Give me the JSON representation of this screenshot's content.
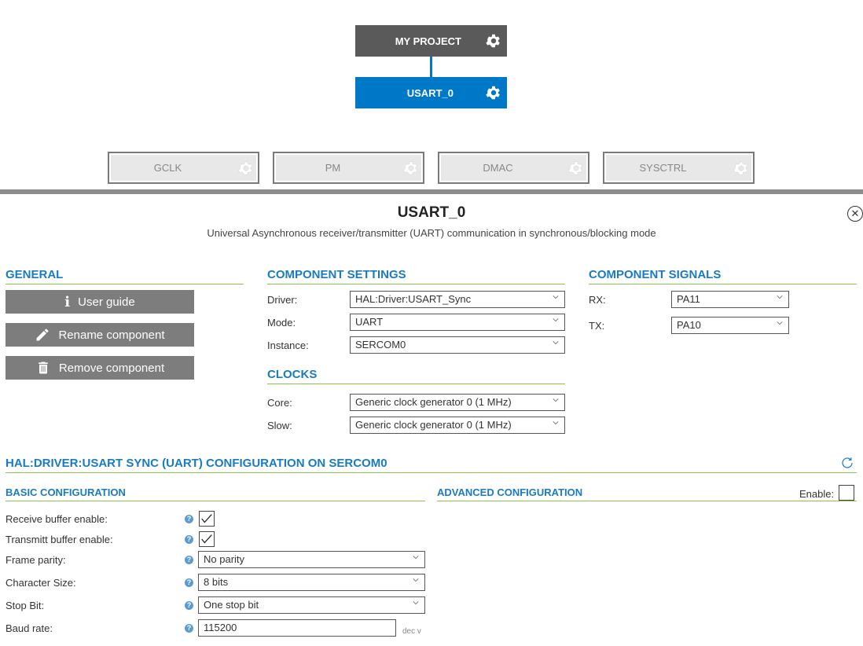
{
  "tree": {
    "root_label": "MY PROJECT",
    "component_label": "USART_0",
    "dependencies": [
      "GCLK",
      "PM",
      "DMAC",
      "SYSCTRL"
    ]
  },
  "colors": {
    "accent": "#0078c8",
    "root": "#5a5a5a",
    "section_head": "#1a7bbf",
    "rule": "#8cc34a",
    "button": "#7d7d7d"
  },
  "panel": {
    "title": "USART_0",
    "subtitle": "Universal Asynchronous receiver/transmitter (UART) communication in synchronous/blocking mode",
    "close_icon": "close-circle-icon"
  },
  "general": {
    "heading": "GENERAL",
    "user_guide": "User guide",
    "rename": "Rename component",
    "remove": "Remove component"
  },
  "component_settings": {
    "heading": "COMPONENT SETTINGS",
    "driver_label": "Driver:",
    "driver_value": "HAL:Driver:USART_Sync",
    "mode_label": "Mode:",
    "mode_value": "UART",
    "instance_label": "Instance:",
    "instance_value": "SERCOM0"
  },
  "clocks": {
    "heading": "CLOCKS",
    "core_label": "Core:",
    "core_value": "Generic clock generator 0 (1 MHz)",
    "slow_label": "Slow:",
    "slow_value": "Generic clock generator 0 (1 MHz)"
  },
  "signals": {
    "heading": "COMPONENT SIGNALS",
    "rx_label": "RX:",
    "rx_value": "PA11",
    "tx_label": "TX:",
    "tx_value": "PA10"
  },
  "config": {
    "heading": "HAL:DRIVER:USART SYNC (UART) CONFIGURATION ON SERCOM0",
    "basic_heading": "BASIC CONFIGURATION",
    "advanced_heading": "ADVANCED CONFIGURATION",
    "enable_label": "Enable:",
    "advanced_enabled": false,
    "receive_label": "Receive buffer enable:",
    "receive_checked": true,
    "transmit_label": "Transmitt buffer enable:",
    "transmit_checked": true,
    "parity_label": "Frame parity:",
    "parity_value": "No parity",
    "charsize_label": "Character Size:",
    "charsize_value": "8 bits",
    "stopbit_label": "Stop Bit:",
    "stopbit_value": "One stop bit",
    "baud_label": "Baud rate:",
    "baud_value": "115200",
    "baud_unit": "dec v"
  }
}
